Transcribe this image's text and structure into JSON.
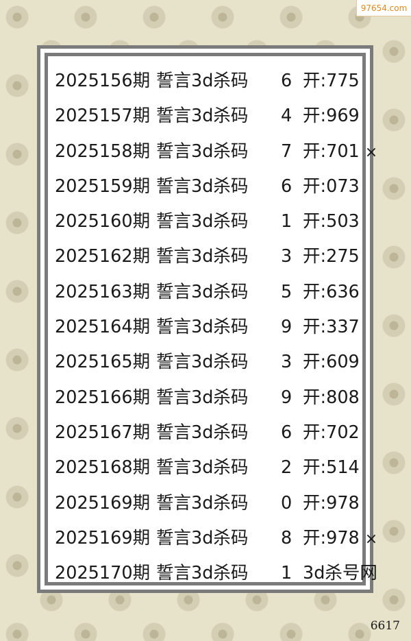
{
  "watermark": "97654.com",
  "footer_id": "6617",
  "rows": [
    {
      "issue": "2025156期",
      "keyword": "誓言3d杀码",
      "kill": "6",
      "result": "开:775",
      "mark": ""
    },
    {
      "issue": "2025157期",
      "keyword": "誓言3d杀码",
      "kill": "4",
      "result": "开:969",
      "mark": ""
    },
    {
      "issue": "2025158期",
      "keyword": "誓言3d杀码",
      "kill": "7",
      "result": "开:701",
      "mark": "×"
    },
    {
      "issue": "2025159期",
      "keyword": "誓言3d杀码",
      "kill": "6",
      "result": "开:073",
      "mark": ""
    },
    {
      "issue": "2025160期",
      "keyword": "誓言3d杀码",
      "kill": "1",
      "result": "开:503",
      "mark": ""
    },
    {
      "issue": "2025162期",
      "keyword": "誓言3d杀码",
      "kill": "3",
      "result": "开:275",
      "mark": ""
    },
    {
      "issue": "2025163期",
      "keyword": "誓言3d杀码",
      "kill": "5",
      "result": "开:636",
      "mark": ""
    },
    {
      "issue": "2025164期",
      "keyword": "誓言3d杀码",
      "kill": "9",
      "result": "开:337",
      "mark": ""
    },
    {
      "issue": "2025165期",
      "keyword": "誓言3d杀码",
      "kill": "3",
      "result": "开:609",
      "mark": ""
    },
    {
      "issue": "2025166期",
      "keyword": "誓言3d杀码",
      "kill": "9",
      "result": "开:808",
      "mark": ""
    },
    {
      "issue": "2025167期",
      "keyword": "誓言3d杀码",
      "kill": "6",
      "result": "开:702",
      "mark": ""
    },
    {
      "issue": "2025168期",
      "keyword": "誓言3d杀码",
      "kill": "2",
      "result": "开:514",
      "mark": ""
    },
    {
      "issue": "2025169期",
      "keyword": "誓言3d杀码",
      "kill": "0",
      "result": "开:978",
      "mark": ""
    },
    {
      "issue": "2025169期",
      "keyword": "誓言3d杀码",
      "kill": "8",
      "result": "开:978",
      "mark": "×"
    },
    {
      "issue": "2025170期",
      "keyword": "誓言3d杀码",
      "kill": "1",
      "result": "3d杀号网",
      "mark": ""
    }
  ]
}
